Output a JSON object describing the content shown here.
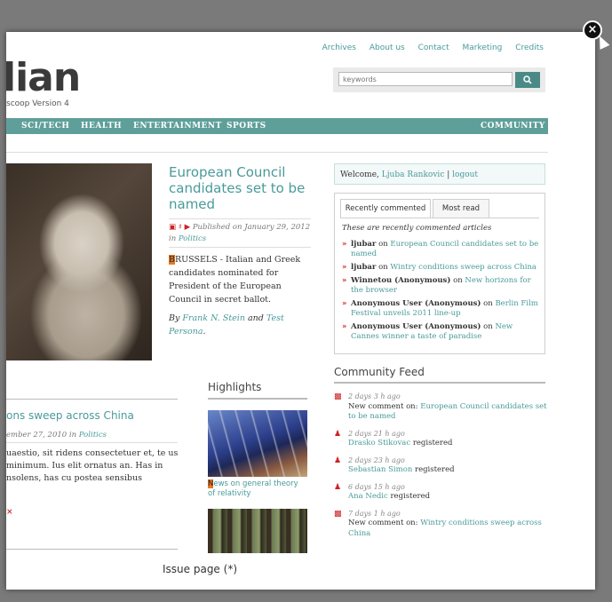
{
  "logo": {
    "text": "lian",
    "subtitle": "scoop Version 4"
  },
  "top_links": [
    "Archives",
    "About us",
    "Contact",
    "Marketing",
    "Credits"
  ],
  "search": {
    "placeholder": "keywords",
    "button_icon": "search-icon"
  },
  "nav": {
    "items": [
      "SCI/TECH",
      "HEALTH",
      "ENTERTAINMENT",
      "SPORTS"
    ],
    "community": "COMMUNITY",
    "color": "#5f9f9a"
  },
  "hero": {
    "title": "European Council candidates set to be named",
    "meta_prefix": "Published on January 29, 2012 in",
    "meta_section": "Politics",
    "dropcap": "B",
    "body": "RUSSELS - Italian and Greek candidates nominated for President of the European Council in secret ballot.",
    "byline_by": "By",
    "author1": "Frank N. Stein",
    "byline_and": "and",
    "author2": "Test Persona",
    "byline_end": "."
  },
  "welcome": {
    "prefix": "Welcome,",
    "user": "Ljuba Rankovic",
    "sep": "|",
    "logout": "logout"
  },
  "comments_box": {
    "tab_recent": "Recently commented",
    "tab_most_read": "Most read",
    "intro": "These are recently commented articles",
    "items": [
      {
        "author": "ljubar",
        "on": "on",
        "article": "European Council candidates set to be named"
      },
      {
        "author": "ljubar",
        "on": "on",
        "article": "Wintry conditions sweep across China"
      },
      {
        "author": "Winnetou (Anonymous)",
        "on": "on",
        "article": "New horizons for the browser"
      },
      {
        "author": "Anonymous User (Anonymous)",
        "on": "on",
        "article": "Berlin Film Festival unveils 2011 line-up"
      },
      {
        "author": "Anonymous User (Anonymous)",
        "on": "on",
        "article": "New Cannes winner a taste of paradise"
      }
    ]
  },
  "feed": {
    "title": "Community Feed",
    "items": [
      {
        "icon": "comment-icon",
        "time": "2 days 3 h ago",
        "text": "New comment on:",
        "link": "European Council candidates set to be named",
        "suffix": ""
      },
      {
        "icon": "user-icon",
        "time": "2 days 21 h ago",
        "text": "",
        "link": "Drasko Stikovac",
        "suffix": "registered"
      },
      {
        "icon": "user-icon",
        "time": "2 days 23 h ago",
        "text": "",
        "link": "Sebastian Simon",
        "suffix": "registered"
      },
      {
        "icon": "user-icon",
        "time": "6 days 15 h ago",
        "text": "",
        "link": "Ana Nedic",
        "suffix": "registered"
      },
      {
        "icon": "comment-icon",
        "time": "7 days 1 h ago",
        "text": "New comment on:",
        "link": "Wintry conditions sweep across China",
        "suffix": ""
      }
    ]
  },
  "article2": {
    "title": "ons sweep across China",
    "meta_prefix": "ember 27, 2010 in",
    "meta_section": "Politics",
    "body": "uaestio, sit ridens consectetuer et, te us minimum. Ius elit ornatus an. Has in nsolens, has cu postea sensibus",
    "mark": "×"
  },
  "highlights": {
    "title": "Highlights",
    "dropcap": "N",
    "caption": "ews on general theory of relativity"
  },
  "issue_page": "Issue page (*)",
  "close": "×"
}
